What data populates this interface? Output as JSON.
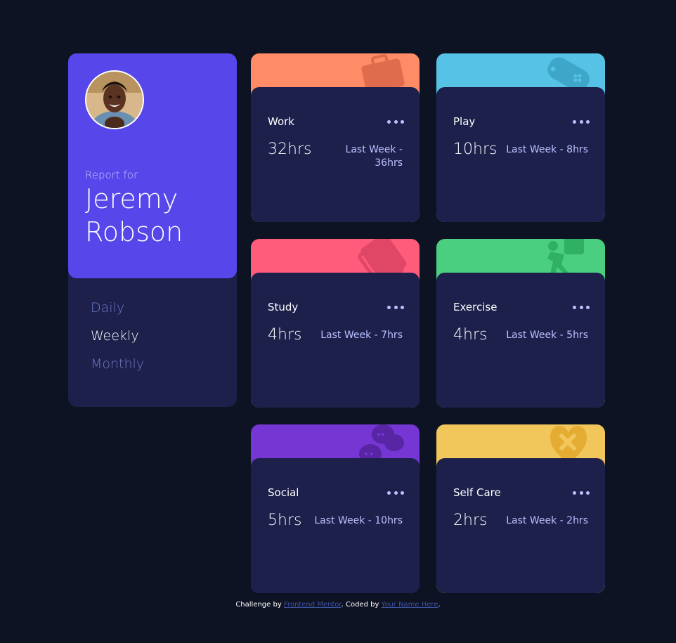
{
  "profile": {
    "report_for": "Report for",
    "name": "Jeremy Robson",
    "periods": [
      "Daily",
      "Weekly",
      "Monthly"
    ],
    "active_period": "Weekly"
  },
  "cards": {
    "work": {
      "title": "Work",
      "current": "32hrs",
      "previous": "Last Week - 36hrs",
      "color": "#ff8c66",
      "icon": "briefcase-icon"
    },
    "play": {
      "title": "Play",
      "current": "10hrs",
      "previous": "Last Week - 8hrs",
      "color": "#56c2e6",
      "icon": "gamepad-icon"
    },
    "study": {
      "title": "Study",
      "current": "4hrs",
      "previous": "Last Week - 7hrs",
      "color": "#ff5c7c",
      "icon": "book-icon"
    },
    "exercise": {
      "title": "Exercise",
      "current": "4hrs",
      "previous": "Last Week - 5hrs",
      "color": "#4acf81",
      "icon": "runner-icon"
    },
    "social": {
      "title": "Social",
      "current": "5hrs",
      "previous": "Last Week - 10hrs",
      "color": "#7536d3",
      "icon": "chat-bubbles-icon"
    },
    "selfcare": {
      "title": "Self Care",
      "current": "2hrs",
      "previous": "Last Week - 2hrs",
      "color": "#f1c65b",
      "icon": "heart-icon"
    }
  },
  "footer": {
    "prefix": "Challenge by ",
    "link1": "Frontend Mentor",
    "middle": ". Coded by ",
    "link2": "Your Name Here",
    "suffix": "."
  }
}
